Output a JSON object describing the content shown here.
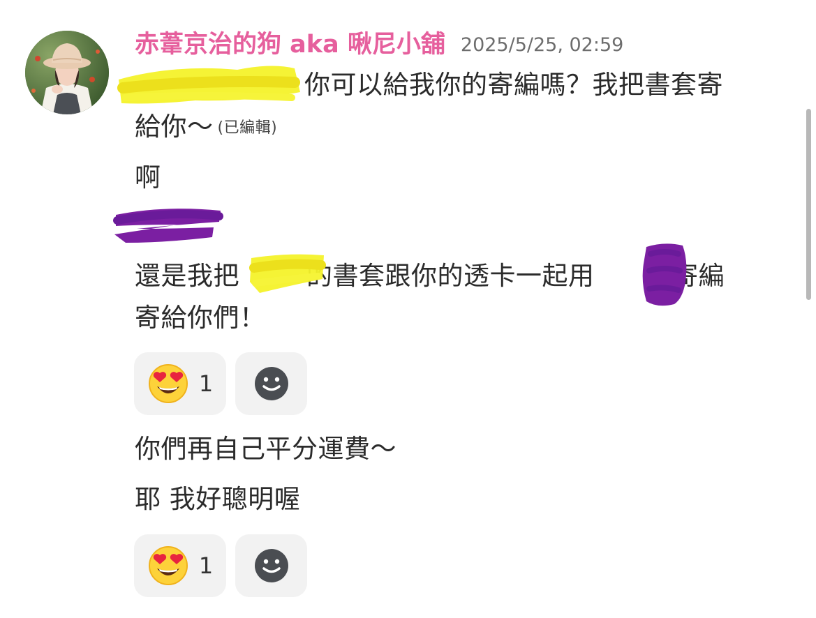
{
  "post": {
    "author": "赤葦京治的狗 aka 啾尼小舖",
    "timestamp": "2025/5/25, 02:59",
    "avatar_icon": "person-with-sunhat-avatar"
  },
  "messages": [
    {
      "id": "m1",
      "line1": "你可以給我你的寄編嗎？我把書套寄",
      "line2": "給你～",
      "edited_label": "(已編輯)"
    },
    {
      "id": "m2",
      "text": "啊"
    },
    {
      "id": "m3",
      "text": ""
    },
    {
      "id": "m4",
      "line1_a": "還是我把",
      "line1_b": "的書套跟你的透卡一起用",
      "line1_c": "的寄編",
      "line2": "寄給你們！"
    },
    {
      "id": "m5",
      "text": "你們再自己平分運費～"
    },
    {
      "id": "m6",
      "text": "耶 我好聰明喔"
    }
  ],
  "reactions": [
    {
      "emoji_icon": "heart-eyes-emoji",
      "count": "1",
      "add_icon": "smiley-face-add-reaction-icon"
    },
    {
      "emoji_icon": "heart-eyes-emoji",
      "count": "1",
      "add_icon": "smiley-face-add-reaction-icon"
    }
  ],
  "colors": {
    "author": "#e65f9d",
    "timestamp": "#6d6d6d",
    "text": "#2b2b2b",
    "pill_bg": "#f2f2f2",
    "highlighter_yellow": "#f4f22a",
    "highlighter_purple": "#7b1fa2"
  }
}
